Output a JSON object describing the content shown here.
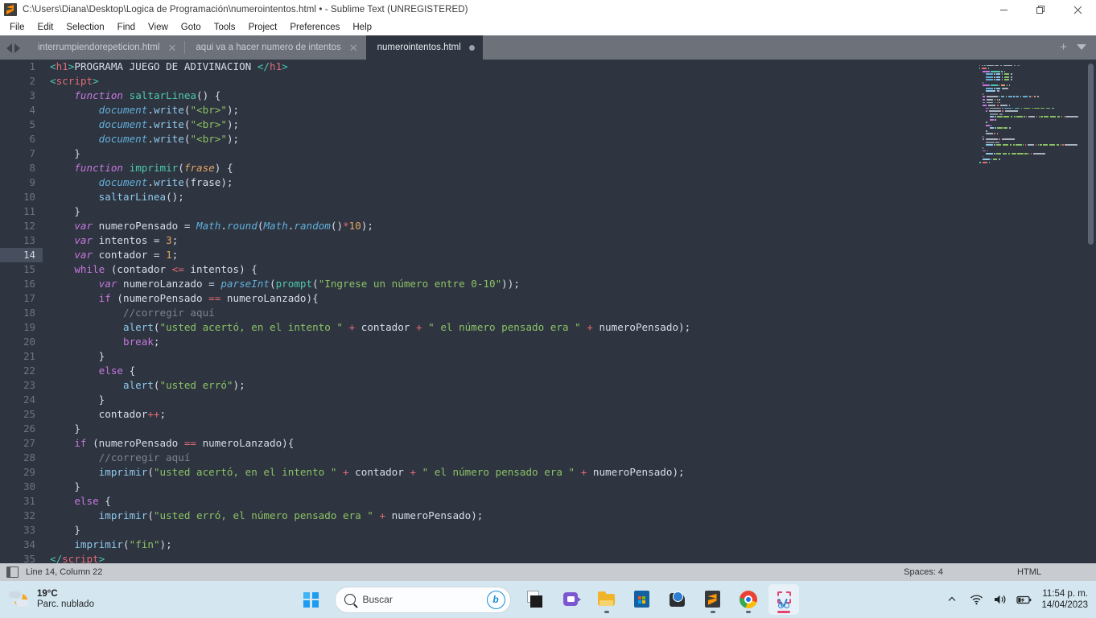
{
  "titlebar": {
    "title": "C:\\Users\\Diana\\Desktop\\Logica de Programación\\numerointentos.html • - Sublime Text (UNREGISTERED)",
    "app_icon": "sublime-text-logo",
    "minimize": "—",
    "restore": "❐",
    "close": "✕"
  },
  "menubar": {
    "items": [
      {
        "label": "File"
      },
      {
        "label": "Edit"
      },
      {
        "label": "Selection"
      },
      {
        "label": "Find"
      },
      {
        "label": "View"
      },
      {
        "label": "Goto"
      },
      {
        "label": "Tools"
      },
      {
        "label": "Project"
      },
      {
        "label": "Preferences"
      },
      {
        "label": "Help"
      }
    ]
  },
  "tabbar": {
    "tabs": [
      {
        "label": "interrumpiendorepeticion.html",
        "close": "✕",
        "active": false
      },
      {
        "label": "aqui va a hacer numero de intentos",
        "close": "✕",
        "active": false
      },
      {
        "label": "numerointentos.html",
        "close": "●",
        "active": true
      }
    ],
    "new_tab": "+",
    "tab_menu": "▾"
  },
  "editor": {
    "lines": [
      {
        "n": "1",
        "tokens": [
          {
            "t": "<",
            "c": "s-tag"
          },
          {
            "t": "h1",
            "c": "s-tagname"
          },
          {
            "t": ">",
            "c": "s-tag"
          },
          {
            "t": "PROGRAMA JUEGO DE ADIVINACION ",
            "c": "s-plain"
          },
          {
            "t": "</",
            "c": "s-tag"
          },
          {
            "t": "h1",
            "c": "s-tagname"
          },
          {
            "t": ">",
            "c": "s-tag"
          }
        ]
      },
      {
        "n": "2",
        "tokens": [
          {
            "t": "<",
            "c": "s-tag"
          },
          {
            "t": "script",
            "c": "s-tagname"
          },
          {
            "t": ">",
            "c": "s-tag"
          }
        ]
      },
      {
        "n": "3",
        "tokens": [
          {
            "t": "    ",
            "c": "s-plain"
          },
          {
            "t": "function",
            "c": "s-kw"
          },
          {
            "t": " ",
            "c": "s-plain"
          },
          {
            "t": "saltarLinea",
            "c": "s-func"
          },
          {
            "t": "() {",
            "c": "s-plain"
          }
        ]
      },
      {
        "n": "4",
        "tokens": [
          {
            "t": "        ",
            "c": "s-plain"
          },
          {
            "t": "document",
            "c": "s-fn"
          },
          {
            "t": ".",
            "c": "s-plain"
          },
          {
            "t": "write",
            "c": "s-call"
          },
          {
            "t": "(",
            "c": "s-plain"
          },
          {
            "t": "\"<br>\"",
            "c": "s-str"
          },
          {
            "t": ");",
            "c": "s-plain"
          }
        ]
      },
      {
        "n": "5",
        "tokens": [
          {
            "t": "        ",
            "c": "s-plain"
          },
          {
            "t": "document",
            "c": "s-fn"
          },
          {
            "t": ".",
            "c": "s-plain"
          },
          {
            "t": "write",
            "c": "s-call"
          },
          {
            "t": "(",
            "c": "s-plain"
          },
          {
            "t": "\"<br>\"",
            "c": "s-str"
          },
          {
            "t": ");",
            "c": "s-plain"
          }
        ]
      },
      {
        "n": "6",
        "tokens": [
          {
            "t": "        ",
            "c": "s-plain"
          },
          {
            "t": "document",
            "c": "s-fn"
          },
          {
            "t": ".",
            "c": "s-plain"
          },
          {
            "t": "write",
            "c": "s-call"
          },
          {
            "t": "(",
            "c": "s-plain"
          },
          {
            "t": "\"<br>\"",
            "c": "s-str"
          },
          {
            "t": ");",
            "c": "s-plain"
          }
        ]
      },
      {
        "n": "7",
        "tokens": [
          {
            "t": "    }",
            "c": "s-plain"
          }
        ]
      },
      {
        "n": "8",
        "tokens": [
          {
            "t": "    ",
            "c": "s-plain"
          },
          {
            "t": "function",
            "c": "s-kw"
          },
          {
            "t": " ",
            "c": "s-plain"
          },
          {
            "t": "imprimir",
            "c": "s-func"
          },
          {
            "t": "(",
            "c": "s-plain"
          },
          {
            "t": "frase",
            "c": "s-param"
          },
          {
            "t": ") {",
            "c": "s-plain"
          }
        ]
      },
      {
        "n": "9",
        "tokens": [
          {
            "t": "        ",
            "c": "s-plain"
          },
          {
            "t": "document",
            "c": "s-fn"
          },
          {
            "t": ".",
            "c": "s-plain"
          },
          {
            "t": "write",
            "c": "s-call"
          },
          {
            "t": "(frase);",
            "c": "s-plain"
          }
        ]
      },
      {
        "n": "10",
        "tokens": [
          {
            "t": "        ",
            "c": "s-plain"
          },
          {
            "t": "saltarLinea",
            "c": "s-call"
          },
          {
            "t": "();",
            "c": "s-plain"
          }
        ]
      },
      {
        "n": "11",
        "tokens": [
          {
            "t": "    }",
            "c": "s-plain"
          }
        ]
      },
      {
        "n": "12",
        "tokens": [
          {
            "t": "    ",
            "c": "s-plain"
          },
          {
            "t": "var",
            "c": "s-kw"
          },
          {
            "t": " numeroPensado = ",
            "c": "s-plain"
          },
          {
            "t": "Math",
            "c": "s-fn"
          },
          {
            "t": ".",
            "c": "s-plain"
          },
          {
            "t": "round",
            "c": "s-fn"
          },
          {
            "t": "(",
            "c": "s-plain"
          },
          {
            "t": "Math",
            "c": "s-fn"
          },
          {
            "t": ".",
            "c": "s-plain"
          },
          {
            "t": "random",
            "c": "s-fn"
          },
          {
            "t": "()",
            "c": "s-plain"
          },
          {
            "t": "*",
            "c": "s-op"
          },
          {
            "t": "10",
            "c": "s-num"
          },
          {
            "t": ");",
            "c": "s-plain"
          }
        ]
      },
      {
        "n": "13",
        "tokens": [
          {
            "t": "    ",
            "c": "s-plain"
          },
          {
            "t": "var",
            "c": "s-kw"
          },
          {
            "t": " intentos = ",
            "c": "s-plain"
          },
          {
            "t": "3",
            "c": "s-num"
          },
          {
            "t": ";",
            "c": "s-plain"
          }
        ]
      },
      {
        "n": "14",
        "active": true,
        "tokens": [
          {
            "t": "    ",
            "c": "s-plain"
          },
          {
            "t": "var",
            "c": "s-kw"
          },
          {
            "t": " contador = ",
            "c": "s-plain"
          },
          {
            "t": "1",
            "c": "s-num"
          },
          {
            "t": ";",
            "c": "s-plain"
          }
        ]
      },
      {
        "n": "15",
        "tokens": [
          {
            "t": "    ",
            "c": "s-plain"
          },
          {
            "t": "while",
            "c": "s-ctl"
          },
          {
            "t": " (contador ",
            "c": "s-plain"
          },
          {
            "t": "<=",
            "c": "s-op"
          },
          {
            "t": " intentos) {",
            "c": "s-plain"
          }
        ]
      },
      {
        "n": "16",
        "tokens": [
          {
            "t": "        ",
            "c": "s-plain"
          },
          {
            "t": "var",
            "c": "s-kw"
          },
          {
            "t": " numeroLanzado = ",
            "c": "s-plain"
          },
          {
            "t": "parseInt",
            "c": "s-fn"
          },
          {
            "t": "(",
            "c": "s-plain"
          },
          {
            "t": "prompt",
            "c": "s-func"
          },
          {
            "t": "(",
            "c": "s-plain"
          },
          {
            "t": "\"Ingrese un número entre 0-10\"",
            "c": "s-str"
          },
          {
            "t": "));",
            "c": "s-plain"
          }
        ]
      },
      {
        "n": "17",
        "tokens": [
          {
            "t": "        ",
            "c": "s-plain"
          },
          {
            "t": "if",
            "c": "s-ctl"
          },
          {
            "t": " (numeroPensado ",
            "c": "s-plain"
          },
          {
            "t": "==",
            "c": "s-op"
          },
          {
            "t": " numeroLanzado){",
            "c": "s-plain"
          }
        ]
      },
      {
        "n": "18",
        "tokens": [
          {
            "t": "            ",
            "c": "s-plain"
          },
          {
            "t": "//corregir aquí",
            "c": "s-cmt"
          }
        ]
      },
      {
        "n": "19",
        "tokens": [
          {
            "t": "            ",
            "c": "s-plain"
          },
          {
            "t": "alert",
            "c": "s-call"
          },
          {
            "t": "(",
            "c": "s-plain"
          },
          {
            "t": "\"usted acertó, en el intento \"",
            "c": "s-str"
          },
          {
            "t": " + ",
            "c": "s-op"
          },
          {
            "t": "contador",
            "c": "s-plain"
          },
          {
            "t": " + ",
            "c": "s-op"
          },
          {
            "t": "\" el número pensado era \"",
            "c": "s-str"
          },
          {
            "t": " + ",
            "c": "s-op"
          },
          {
            "t": "numeroPensado);",
            "c": "s-plain"
          }
        ]
      },
      {
        "n": "20",
        "tokens": [
          {
            "t": "            ",
            "c": "s-plain"
          },
          {
            "t": "break",
            "c": "s-ctl"
          },
          {
            "t": ";",
            "c": "s-plain"
          }
        ]
      },
      {
        "n": "21",
        "tokens": [
          {
            "t": "        }",
            "c": "s-plain"
          }
        ]
      },
      {
        "n": "22",
        "tokens": [
          {
            "t": "        ",
            "c": "s-plain"
          },
          {
            "t": "else",
            "c": "s-ctl"
          },
          {
            "t": " {",
            "c": "s-plain"
          }
        ]
      },
      {
        "n": "23",
        "tokens": [
          {
            "t": "            ",
            "c": "s-plain"
          },
          {
            "t": "alert",
            "c": "s-call"
          },
          {
            "t": "(",
            "c": "s-plain"
          },
          {
            "t": "\"usted erró\"",
            "c": "s-str"
          },
          {
            "t": ");",
            "c": "s-plain"
          }
        ]
      },
      {
        "n": "24",
        "tokens": [
          {
            "t": "        }",
            "c": "s-plain"
          }
        ]
      },
      {
        "n": "25",
        "tokens": [
          {
            "t": "        contador",
            "c": "s-plain"
          },
          {
            "t": "++",
            "c": "s-op"
          },
          {
            "t": ";",
            "c": "s-plain"
          }
        ]
      },
      {
        "n": "26",
        "tokens": [
          {
            "t": "    }",
            "c": "s-plain"
          }
        ]
      },
      {
        "n": "27",
        "tokens": [
          {
            "t": "    ",
            "c": "s-plain"
          },
          {
            "t": "if",
            "c": "s-ctl"
          },
          {
            "t": " (numeroPensado ",
            "c": "s-plain"
          },
          {
            "t": "==",
            "c": "s-op"
          },
          {
            "t": " numeroLanzado){",
            "c": "s-plain"
          }
        ]
      },
      {
        "n": "28",
        "tokens": [
          {
            "t": "        ",
            "c": "s-plain"
          },
          {
            "t": "//corregir aquí",
            "c": "s-cmt"
          }
        ]
      },
      {
        "n": "29",
        "tokens": [
          {
            "t": "        ",
            "c": "s-plain"
          },
          {
            "t": "imprimir",
            "c": "s-call"
          },
          {
            "t": "(",
            "c": "s-plain"
          },
          {
            "t": "\"usted acertó, en el intento \"",
            "c": "s-str"
          },
          {
            "t": " + ",
            "c": "s-op"
          },
          {
            "t": "contador",
            "c": "s-plain"
          },
          {
            "t": " + ",
            "c": "s-op"
          },
          {
            "t": "\" el número pensado era \"",
            "c": "s-str"
          },
          {
            "t": " + ",
            "c": "s-op"
          },
          {
            "t": "numeroPensado);",
            "c": "s-plain"
          }
        ]
      },
      {
        "n": "30",
        "tokens": [
          {
            "t": "    }",
            "c": "s-plain"
          }
        ]
      },
      {
        "n": "31",
        "tokens": [
          {
            "t": "    ",
            "c": "s-plain"
          },
          {
            "t": "else",
            "c": "s-ctl"
          },
          {
            "t": " {",
            "c": "s-plain"
          }
        ]
      },
      {
        "n": "32",
        "tokens": [
          {
            "t": "        ",
            "c": "s-plain"
          },
          {
            "t": "imprimir",
            "c": "s-call"
          },
          {
            "t": "(",
            "c": "s-plain"
          },
          {
            "t": "\"usted erró, el número pensado era \"",
            "c": "s-str"
          },
          {
            "t": " + ",
            "c": "s-op"
          },
          {
            "t": "numeroPensado);",
            "c": "s-plain"
          }
        ]
      },
      {
        "n": "33",
        "tokens": [
          {
            "t": "    }",
            "c": "s-plain"
          }
        ]
      },
      {
        "n": "34",
        "tokens": [
          {
            "t": "    ",
            "c": "s-plain"
          },
          {
            "t": "imprimir",
            "c": "s-call"
          },
          {
            "t": "(",
            "c": "s-plain"
          },
          {
            "t": "\"fin\"",
            "c": "s-str"
          },
          {
            "t": ");",
            "c": "s-plain"
          }
        ]
      },
      {
        "n": "35",
        "tokens": [
          {
            "t": "</",
            "c": "s-tag"
          },
          {
            "t": "script",
            "c": "s-tagname"
          },
          {
            "t": ">",
            "c": "s-tag"
          }
        ]
      }
    ]
  },
  "statusbar": {
    "sidebar_icon": "sidebar-toggle-icon",
    "cursor": "Line 14, Column 22",
    "indent": "Spaces: 4",
    "syntax": "HTML"
  },
  "taskbar": {
    "weather": {
      "temp": "19°C",
      "condition": "Parc. nublado",
      "icon": "partly-cloudy-night-icon"
    },
    "start": "windows-logo",
    "search": {
      "placeholder": "Buscar",
      "icon": "search-icon",
      "assistant": "bing-chat-icon"
    },
    "apps": [
      {
        "name": "task-view",
        "label": "Task View"
      },
      {
        "name": "microsoft-teams",
        "label": "Microsoft Teams"
      },
      {
        "name": "file-explorer",
        "label": "Explorador de archivos"
      },
      {
        "name": "microsoft-store",
        "label": "Microsoft Store"
      },
      {
        "name": "dark-app",
        "label": "App"
      },
      {
        "name": "sublime-text",
        "label": "Sublime Text"
      },
      {
        "name": "google-chrome",
        "label": "Google Chrome"
      },
      {
        "name": "snipping-tool",
        "label": "Recortes"
      }
    ],
    "tray": {
      "overflow": "^",
      "wifi": "wifi-icon",
      "volume": "speaker-icon",
      "battery": "battery-charging-icon",
      "time": "11:54 p. m.",
      "date": "14/04/2023"
    }
  }
}
